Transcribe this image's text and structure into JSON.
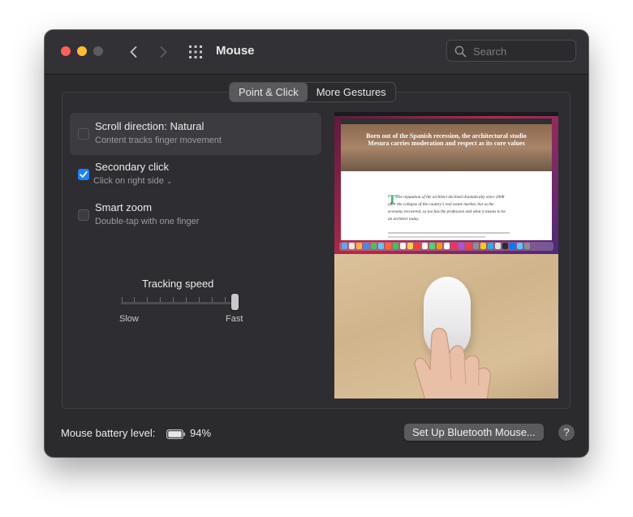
{
  "window": {
    "title": "Mouse"
  },
  "search": {
    "placeholder": "Search"
  },
  "tabs": [
    {
      "label": "Point & Click",
      "active": true
    },
    {
      "label": "More Gestures",
      "active": false
    }
  ],
  "options": [
    {
      "title": "Scroll direction: Natural",
      "subtitle": "Content tracks finger movement",
      "checked": false
    },
    {
      "title": "Secondary click",
      "subtitle": "Click on right side",
      "checked": true
    },
    {
      "title": "Smart zoom",
      "subtitle": "Double-tap with one finger",
      "checked": false
    }
  ],
  "tracking": {
    "label": "Tracking speed",
    "min_label": "Slow",
    "max_label": "Fast",
    "level": 1.0
  },
  "preview": {
    "headline": "Born out of the Spanish recession, the architectural studio Mesura carries moderation and respect as its core values",
    "article": "The reputation of the architect declined dramatically since 2008 after the collapse of the country's real estate market, but as the economy recovered, so too has the profession and what it means to be an architect today."
  },
  "footer": {
    "battery_label": "Mouse battery level:",
    "battery_percent": "94%",
    "setup_button": "Set Up Bluetooth Mouse...",
    "help": "?"
  },
  "colors": {
    "window_bg": "#2b2a2d",
    "accent": "#1f7ff5",
    "close": "#fe5f57",
    "minimize": "#febc2e"
  }
}
